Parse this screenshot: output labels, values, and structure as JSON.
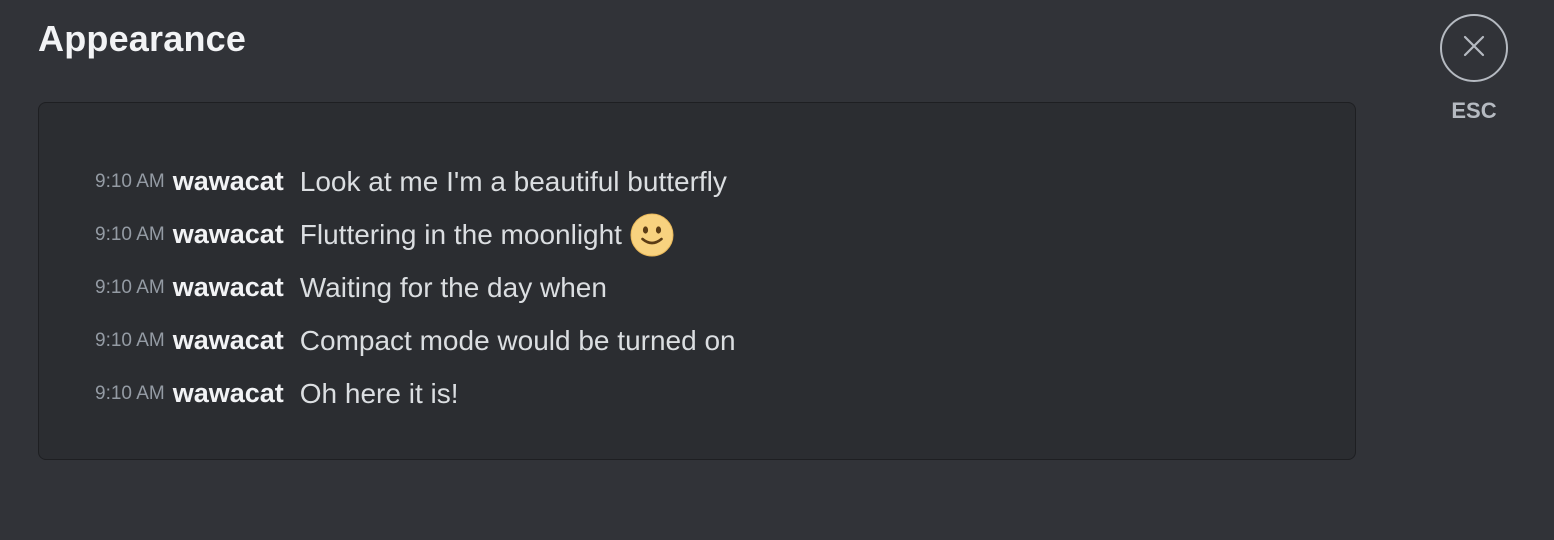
{
  "header": {
    "title": "Appearance"
  },
  "preview": {
    "messages": [
      {
        "time": "9:10 AM",
        "user": "wawacat",
        "text": "Look at me I'm a beautiful butterfly",
        "emoji": null
      },
      {
        "time": "9:10 AM",
        "user": "wawacat",
        "text": "Fluttering in the moonlight",
        "emoji": "slightly-smiling-face-emoji"
      },
      {
        "time": "9:10 AM",
        "user": "wawacat",
        "text": "Waiting for the day when",
        "emoji": null
      },
      {
        "time": "9:10 AM",
        "user": "wawacat",
        "text": "Compact mode would be turned on",
        "emoji": null
      },
      {
        "time": "9:10 AM",
        "user": "wawacat",
        "text": "Oh here it is!",
        "emoji": null
      }
    ]
  },
  "close": {
    "icon": "close-icon",
    "label": "ESC"
  },
  "colors": {
    "background": "#313338",
    "preview_background": "#2b2d31",
    "text_primary": "#f2f3f5",
    "text_muted": "#949ba4",
    "emoji_face": "#f8d27f"
  }
}
